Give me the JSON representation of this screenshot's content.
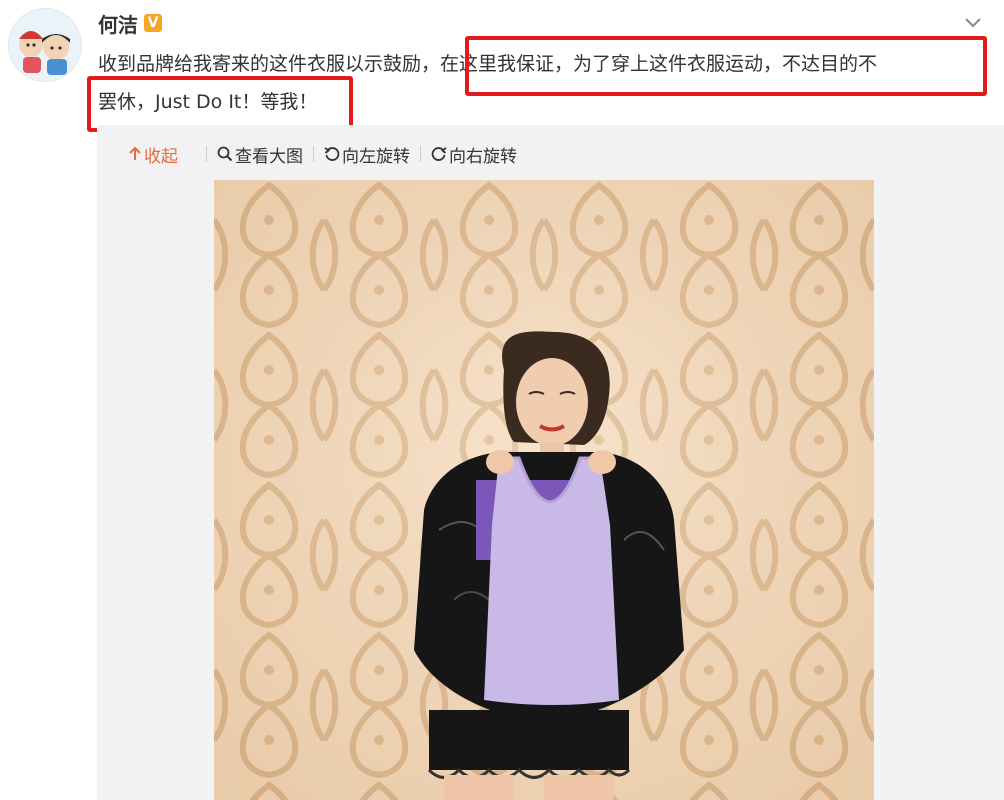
{
  "post": {
    "author": "何洁",
    "verified_badge": "V",
    "text_line1": "收到品牌给我寄来的这件衣服以示鼓励，在这里我保证，为了穿上这件衣服运动，不达目的不",
    "text_line2": "罢休，Just Do It！等我！"
  },
  "toolbar": {
    "collapse_label": "收起",
    "view_large_label": "查看大图",
    "rotate_left_label": "向左旋转",
    "rotate_right_label": "向右旋转"
  },
  "colors": {
    "highlight": "#e21a1a",
    "accent": "#e56c3f",
    "verified": "#f5a623"
  },
  "icons": [
    "chevron-down-icon",
    "arrow-up-icon",
    "magnify-icon",
    "rotate-left-icon",
    "rotate-right-icon"
  ]
}
